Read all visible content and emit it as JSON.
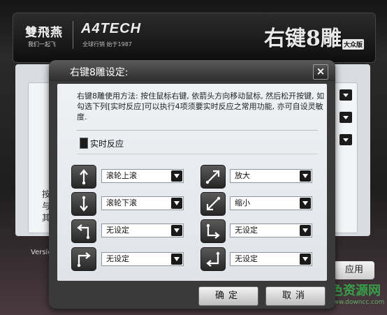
{
  "app": {
    "brand_chinese": "雙飛燕",
    "brand_chinese_sub": "我们一起飞",
    "brand_latin": "A4TECH",
    "brand_latin_sub": "全球行销  始于1987",
    "product_title": "右键8雕",
    "product_badge": "大众版",
    "side_text_lines": [
      "按",
      "与",
      "其"
    ],
    "version_label": "Versio",
    "apply_label": "应用",
    "watermark": "绿色资源网",
    "watermark_sub": "www.downcc.com"
  },
  "dialog": {
    "title": "右键8雕设定:",
    "close_label": "×",
    "description": "右键8雕使用方法: 按住鼠标右键, 依箭头方向移动鼠标, 然后松开按键, 如勾选下列[实时反应]可以执行4项须要实时反应之常用功能, 亦可自设灵敏度.",
    "realtime_label": "实时反应",
    "gestures": [
      {
        "icon": "arrow-up-icon",
        "value": "滚轮上滚"
      },
      {
        "icon": "arrow-down-icon",
        "value": "滚轮下滚"
      },
      {
        "icon": "arrow-up-left-turn-icon",
        "value": "无设定"
      },
      {
        "icon": "arrow-right-turn-icon",
        "value": "无设定"
      },
      {
        "icon": "arrow-diagonal-up-right-icon",
        "value": "放大"
      },
      {
        "icon": "arrow-diagonal-down-left-icon",
        "value": "缩小"
      },
      {
        "icon": "arrow-right-up-turn-icon",
        "value": "无设定"
      },
      {
        "icon": "arrow-down-left-turn-icon",
        "value": "无设定"
      }
    ],
    "ok_label": "确定",
    "cancel_label": "取消"
  }
}
